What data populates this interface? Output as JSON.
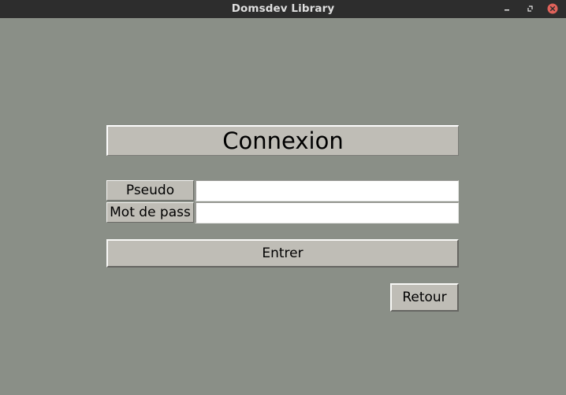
{
  "window": {
    "title": "Domsdev Library",
    "controls": [
      "minimize-icon",
      "maximize-icon",
      "close-icon"
    ],
    "colors": {
      "titlebar": "#2d2d2d",
      "close_button": "#e0625a",
      "background": "#8a8f87",
      "widget": "#bfbdb6"
    }
  },
  "login": {
    "heading": "Connexion",
    "username_label": "Pseudo",
    "username_value": "",
    "password_label": "Mot de pass",
    "password_value": "",
    "submit_label": "Entrer",
    "back_label": "Retour"
  }
}
